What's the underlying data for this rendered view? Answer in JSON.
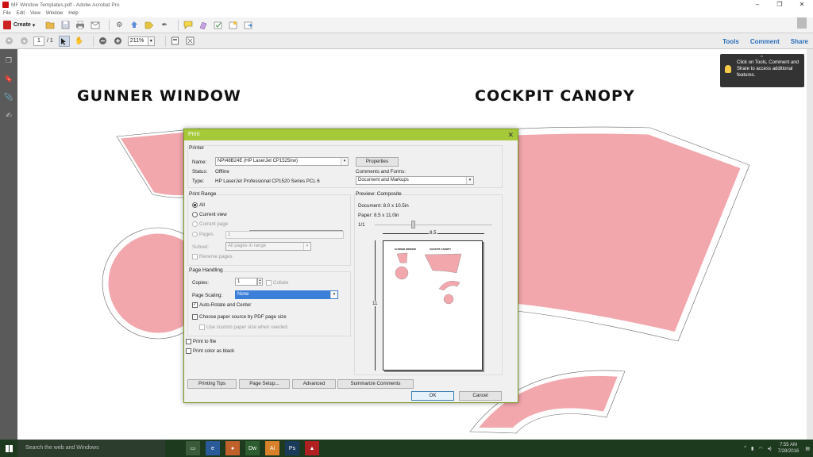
{
  "window": {
    "title": "MF Window Templates.pdf - Adobe Acrobat Pro",
    "controls": [
      "–",
      "❐",
      "✕"
    ]
  },
  "menu": [
    "File",
    "Edit",
    "View",
    "Window",
    "Help"
  ],
  "toolbar": {
    "create_label": "Create",
    "create_caret": "▾"
  },
  "navbar": {
    "current_page": "1",
    "total_pages": "/ 1",
    "zoom": "211%",
    "links": [
      "Tools",
      "Comment",
      "Share"
    ]
  },
  "tooltip": {
    "text": "Click on Tools, Comment and Share to access additional features."
  },
  "document": {
    "heading_left": "GUNNER WINDOW",
    "heading_right": "COCKPIT CANOPY",
    "shape_color": "#f2a7ad"
  },
  "print_dialog": {
    "title": "Print",
    "printer": {
      "section": "Printer",
      "name_label": "Name:",
      "name_value": "NPI48B24E (HP LaserJet CP1525nw)",
      "properties_button": "Properties",
      "status_label": "Status:",
      "status_value": "Offline",
      "type_label": "Type:",
      "type_value": "HP LaserJet Professional CP1520 Series PCL 6",
      "comments_label": "Comments and Forms:",
      "comments_value": "Document and Markups"
    },
    "print_range": {
      "section": "Print Range",
      "all": "All",
      "current_view": "Current view",
      "current_page": "Current page",
      "pages": "Pages",
      "pages_value": "1",
      "subset_label": "Subset:",
      "subset_value": "All pages in range",
      "reverse": "Reverse pages"
    },
    "page_handling": {
      "section": "Page Handling",
      "copies_label": "Copies:",
      "copies_value": "1",
      "collate": "Collate",
      "scaling_label": "Page Scaling:",
      "scaling_value": "None",
      "auto_rotate": "Auto-Rotate and Center",
      "choose_source": "Choose paper source by PDF page size",
      "custom_size": "Use custom paper size when needed"
    },
    "print_to_file": "Print to file",
    "print_black": "Print color as black",
    "preview": {
      "section": "Preview: Composite",
      "document": "Document: 8.0 x 10.5in",
      "paper": "Paper: 8.5 x 11.0in",
      "page_count": "1/1",
      "width_label": "8.5",
      "height_label": "11",
      "thumb_left": "GUNNER WINDOW",
      "thumb_right": "COCKPIT CANOPY"
    },
    "buttons": {
      "printing_tips": "Printing Tips",
      "page_setup": "Page Setup...",
      "advanced": "Advanced",
      "summarize": "Summarize Comments",
      "ok": "OK",
      "cancel": "Cancel"
    }
  },
  "taskbar": {
    "search_placeholder": "Search the web and Windows",
    "apps": [
      "Dw",
      "Ai",
      "Ps"
    ],
    "time": "7:55 AM",
    "date": "7/28/2016"
  }
}
